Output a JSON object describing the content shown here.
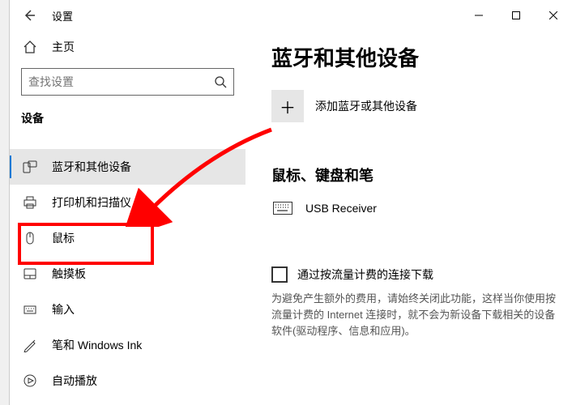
{
  "window": {
    "title": "设置",
    "back_aria": "返回"
  },
  "sidebar": {
    "home_label": "主页",
    "search_placeholder": "查找设置",
    "category_label": "设备",
    "items": [
      {
        "label": "蓝牙和其他设备",
        "icon": "bluetooth-devices"
      },
      {
        "label": "打印机和扫描仪",
        "icon": "printer"
      },
      {
        "label": "鼠标",
        "icon": "mouse"
      },
      {
        "label": "触摸板",
        "icon": "touchpad"
      },
      {
        "label": "输入",
        "icon": "typing"
      },
      {
        "label": "笔和 Windows Ink",
        "icon": "pen"
      },
      {
        "label": "自动播放",
        "icon": "autoplay"
      }
    ]
  },
  "main": {
    "page_title": "蓝牙和其他设备",
    "add_label": "添加蓝牙或其他设备",
    "section_mouse_title": "鼠标、键盘和笔",
    "device1": "USB Receiver",
    "metered_checkbox_label": "通过按流量计费的连接下载",
    "metered_desc": "为避免产生额外的费用，请始终关闭此功能，这样当你使用按流量计费的 Internet 连接时，就不会为新设备下载相关的设备软件(驱动程序、信息和应用)。"
  }
}
